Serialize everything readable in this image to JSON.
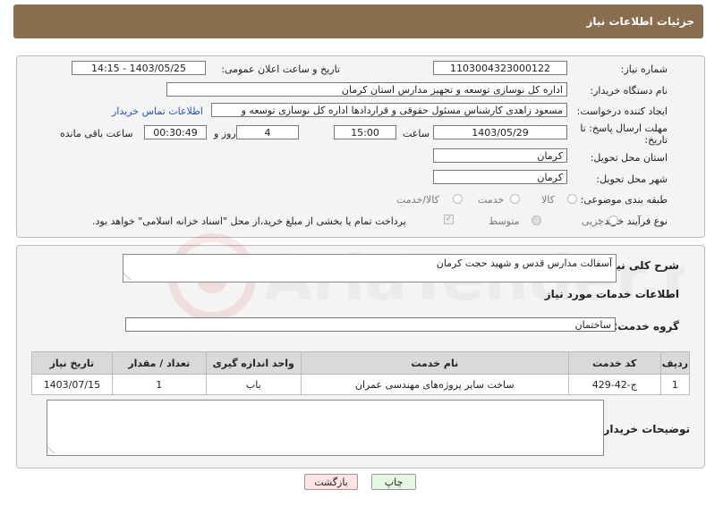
{
  "header": {
    "title": "جزئیات اطلاعات نیاز"
  },
  "form": {
    "need_number_label": "شماره نیاز:",
    "need_number": "1103004323000122",
    "announce_label": "تاریخ و ساعت اعلان عمومی:",
    "announce_value": "1403/05/25 - 14:15",
    "buyer_label": "نام دستگاه خریدار:",
    "buyer_value": "اداره کل نوسازی  توسعه و تجهیز مدارس استان کرمان",
    "creator_label": "ایجاد کننده درخواست:",
    "creator_value": "مسعود زاهدی کارشناس مسئول حقوقی و قراردادها اداره کل نوسازی  توسعه و",
    "contact_link": "اطلاعات تماس خریدار",
    "deadline_label": "مهلت ارسال پاسخ: تا تاریخ:",
    "deadline_date": "1403/05/29",
    "time_label": "ساعت",
    "deadline_time": "15:00",
    "days_value": "4",
    "days_label": "روز و",
    "remaining_time": "00:30:49",
    "remaining_label": "ساعت باقی مانده",
    "province_label": "استان محل تحویل:",
    "province_value": "کرمان",
    "city_label": "شهر محل تحویل:",
    "city_value": "کرمان",
    "category_label": "طبقه بندی موضوعی:",
    "category_options": [
      "کالا",
      "خدمت",
      "کالا/خدمت"
    ],
    "process_label": "نوع فرآیند خرید :",
    "process_options": [
      "جزیی",
      "متوسط"
    ],
    "payment_note": "پرداخت تمام یا بخشی از مبلغ خرید،از محل \"اسناد خزانه اسلامی\" خواهد بود."
  },
  "details": {
    "summary_label": "شرح کلی نیاز:",
    "summary_value": "آسفالت مدارس قدس و شهید حجت کرمان",
    "services_title": "اطلاعات خدمات مورد نیاز",
    "group_label": "گروه خدمت:",
    "group_value": "ساختمان",
    "table": {
      "headers": [
        "ردیف",
        "کد خدمت",
        "نام خدمت",
        "واحد اندازه گیری",
        "تعداد / مقدار",
        "تاریخ نیاز"
      ],
      "rows": [
        [
          "1",
          "ج-42-429",
          "ساخت سایر پروژه‌های مهندسی عمران",
          "باب",
          "1",
          "1403/07/15"
        ]
      ]
    },
    "buyer_notes_label": "توضیحات خریدار:"
  },
  "buttons": {
    "print": "چاپ",
    "back": "بازگشت"
  },
  "watermark": {
    "text": "AriaTender.neT"
  }
}
